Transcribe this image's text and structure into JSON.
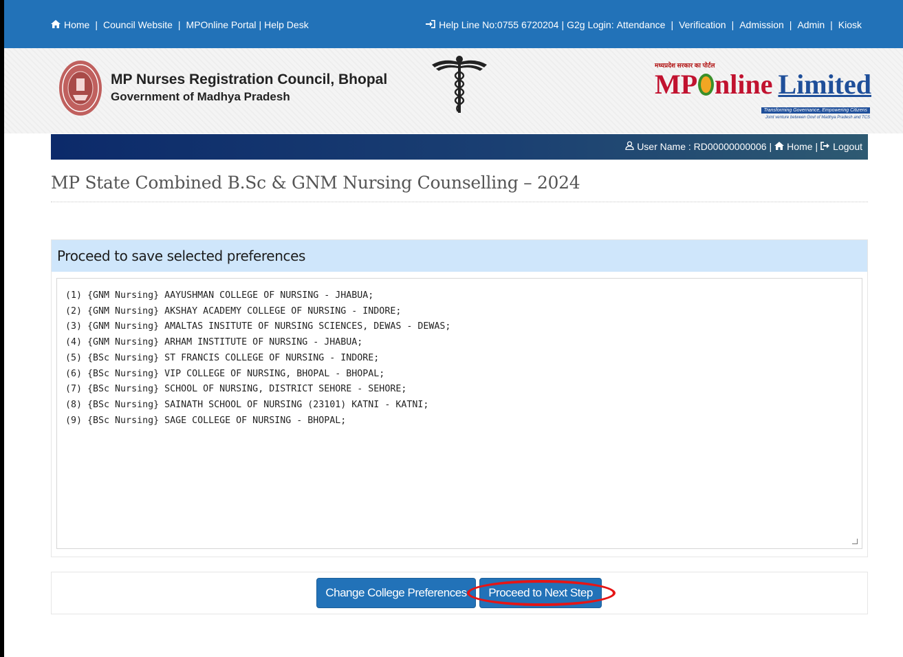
{
  "topbar": {
    "left_links": [
      "Home",
      "Council Website",
      "MPOnline Portal",
      "Help Desk"
    ],
    "helpline": "Help Line No:0755 6720204",
    "g2g_label": "G2g Login:",
    "right_links": [
      "Attendance",
      "Verification",
      "Admission",
      "Admin",
      "Kiosk"
    ],
    "icons": {
      "home": "home-icon",
      "login": "sign-in-icon"
    }
  },
  "header": {
    "council_name": "MP Nurses Registration Council, Bhopal",
    "government": "Government of Madhya Pradesh",
    "mponline_hindi": "मध्यप्रदेश सरकार का पोर्टल",
    "mponline_mp": "MP",
    "mponline_rest": "nline",
    "mponline_limited": "Limited",
    "mponline_tagline": "Transforming Governance, Empowering Citizens",
    "mponline_venture": "Joint venture between Govt of Madhya Pradesh and TCS"
  },
  "userbar": {
    "user_label": "User Name : RD00000000006",
    "home_label": "Home",
    "logout_label": "Logout"
  },
  "page_title": "MP State Combined B.Sc & GNM Nursing Counselling – 2024",
  "panel": {
    "heading": "Proceed to save selected preferences",
    "preferences_text": "(1) {GNM Nursing} AAYUSHMAN COLLEGE OF NURSING - JHABUA;\n(2) {GNM Nursing} AKSHAY ACADEMY COLLEGE OF NURSING - INDORE;\n(3) {GNM Nursing} AMALTAS INSITUTE OF NURSING SCIENCES, DEWAS - DEWAS;\n(4) {GNM Nursing} ARHAM INSTITUTE OF NURSING - JHABUA;\n(5) {BSc Nursing} ST FRANCIS COLLEGE OF NURSING - INDORE;\n(6) {BSc Nursing} VIP COLLEGE OF NURSING, BHOPAL - BHOPAL;\n(7) {BSc Nursing} SCHOOL OF NURSING, DISTRICT SEHORE - SEHORE;\n(8) {BSc Nursing} SAINATH SCHOOL OF NURSING (23101) KATNI - KATNI;\n(9) {BSc Nursing} SAGE COLLEGE OF NURSING - BHOPAL;"
  },
  "actions": {
    "change_label": "Change College Preferences",
    "next_label": "Proceed to Next Step"
  },
  "colors": {
    "topbar": "#2272b8",
    "button": "#2272b8",
    "panel_head": "#cfe6fb",
    "highlight": "#e51515"
  }
}
